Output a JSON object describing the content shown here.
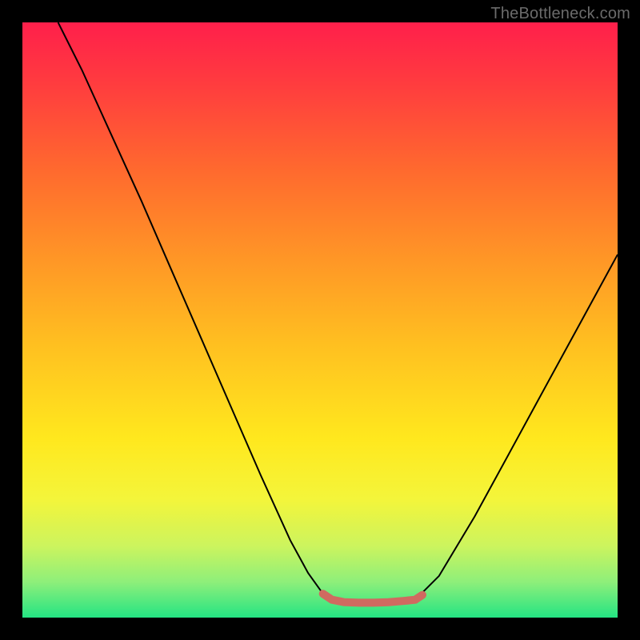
{
  "watermark": "TheBottleneck.com",
  "colors": {
    "frame": "#000000",
    "gradient_stops": [
      {
        "offset": 0.0,
        "color": "#ff1f4b"
      },
      {
        "offset": 0.1,
        "color": "#ff3b3f"
      },
      {
        "offset": 0.25,
        "color": "#ff6a2e"
      },
      {
        "offset": 0.4,
        "color": "#ff9726"
      },
      {
        "offset": 0.55,
        "color": "#ffc220"
      },
      {
        "offset": 0.7,
        "color": "#ffe81e"
      },
      {
        "offset": 0.8,
        "color": "#f4f53a"
      },
      {
        "offset": 0.88,
        "color": "#ccf45e"
      },
      {
        "offset": 0.94,
        "color": "#8eef7a"
      },
      {
        "offset": 1.0,
        "color": "#24e483"
      }
    ],
    "curve": "#000000",
    "marker": "#d06a60"
  },
  "chart_data": {
    "type": "line",
    "title": "",
    "xlabel": "",
    "ylabel": "",
    "xlim": [
      0,
      1
    ],
    "ylim": [
      0,
      1
    ],
    "series": [
      {
        "name": "left-branch",
        "x": [
          0.06,
          0.1,
          0.15,
          0.2,
          0.25,
          0.3,
          0.35,
          0.4,
          0.45,
          0.48,
          0.505,
          0.52
        ],
        "y": [
          1.0,
          0.92,
          0.81,
          0.7,
          0.585,
          0.47,
          0.355,
          0.24,
          0.13,
          0.075,
          0.04,
          0.03
        ]
      },
      {
        "name": "flat-bottom",
        "x": [
          0.52,
          0.56,
          0.6,
          0.64,
          0.66
        ],
        "y": [
          0.03,
          0.025,
          0.025,
          0.028,
          0.03
        ]
      },
      {
        "name": "right-branch",
        "x": [
          0.66,
          0.7,
          0.76,
          0.82,
          0.88,
          0.94,
          1.0
        ],
        "y": [
          0.03,
          0.07,
          0.17,
          0.28,
          0.39,
          0.5,
          0.61
        ]
      },
      {
        "name": "bottom-marker",
        "x": [
          0.505,
          0.52,
          0.54,
          0.565,
          0.59,
          0.615,
          0.64,
          0.66,
          0.672
        ],
        "y": [
          0.04,
          0.03,
          0.026,
          0.025,
          0.025,
          0.026,
          0.028,
          0.03,
          0.038
        ]
      }
    ],
    "legend": false,
    "grid": false
  }
}
